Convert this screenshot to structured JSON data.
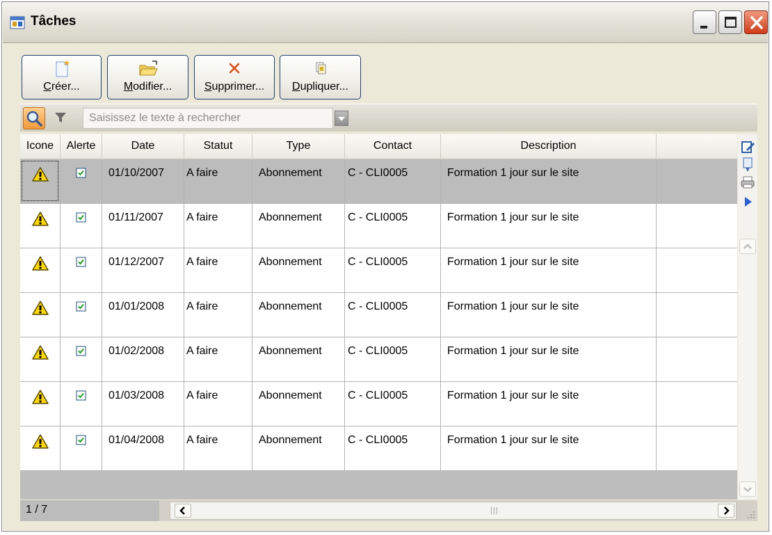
{
  "window": {
    "title": "Tâches",
    "icon": "calendar-task-icon",
    "controls": [
      "minimize",
      "maximize",
      "close"
    ]
  },
  "toolbar": {
    "create": {
      "mnemonic": "C",
      "rest": "réer...",
      "icon": "new-document-icon"
    },
    "modify": {
      "mnemonic": "M",
      "rest": "odifier...",
      "icon": "open-folder-icon"
    },
    "delete": {
      "mnemonic": "S",
      "rest": "upprimer...",
      "icon": "delete-x-icon"
    },
    "duplicate": {
      "mnemonic": "D",
      "rest": "upliquer...",
      "icon": "copy-icon"
    }
  },
  "search": {
    "placeholder": "Saisissez le texte à rechercher"
  },
  "table": {
    "columns": {
      "icone": "Icone",
      "alerte": "Alerte",
      "date": "Date",
      "statut": "Statut",
      "type": "Type",
      "contact": "Contact",
      "description": "Description"
    },
    "rows": [
      {
        "date": "01/10/2007",
        "statut": "A faire",
        "type": "Abonnement",
        "contact": "C - CLI0005",
        "description": "Formation 1 jour sur le site",
        "alerte": true,
        "selected": true
      },
      {
        "date": "01/11/2007",
        "statut": "A faire",
        "type": "Abonnement",
        "contact": "C - CLI0005",
        "description": "Formation 1 jour sur le site",
        "alerte": true,
        "selected": false
      },
      {
        "date": "01/12/2007",
        "statut": "A faire",
        "type": "Abonnement",
        "contact": "C - CLI0005",
        "description": "Formation 1 jour sur le site",
        "alerte": true,
        "selected": false
      },
      {
        "date": "01/01/2008",
        "statut": "A faire",
        "type": "Abonnement",
        "contact": "C - CLI0005",
        "description": "Formation 1 jour sur le site",
        "alerte": true,
        "selected": false
      },
      {
        "date": "01/02/2008",
        "statut": "A faire",
        "type": "Abonnement",
        "contact": "C - CLI0005",
        "description": "Formation 1 jour sur le site",
        "alerte": true,
        "selected": false
      },
      {
        "date": "01/03/2008",
        "statut": "A faire",
        "type": "Abonnement",
        "contact": "C - CLI0005",
        "description": "Formation 1 jour sur le site",
        "alerte": true,
        "selected": false
      },
      {
        "date": "01/04/2008",
        "statut": "A faire",
        "type": "Abonnement",
        "contact": "C - CLI0005",
        "description": "Formation 1 jour sur le site",
        "alerte": true,
        "selected": false
      }
    ]
  },
  "status": {
    "pager": "1 / 7"
  },
  "colors": {
    "selected_row": "#bcbcbc",
    "close_button": "#cf3a17",
    "button_border": "#1f3f77"
  }
}
